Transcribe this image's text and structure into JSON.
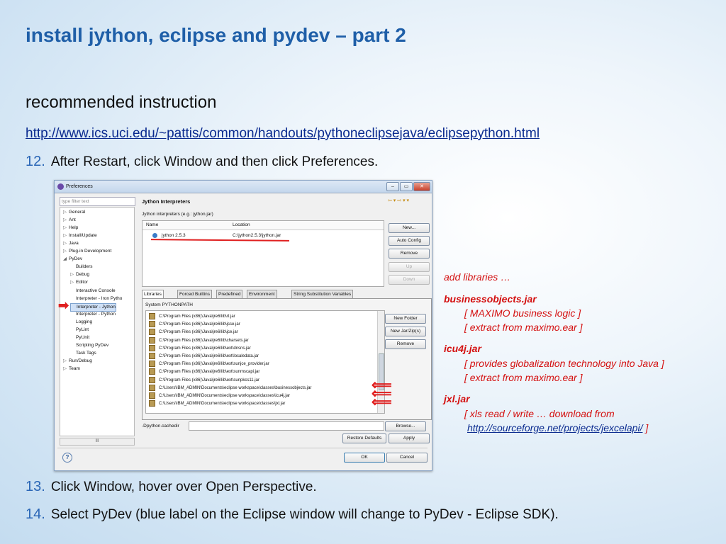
{
  "slide": {
    "title": "install jython, eclipse and pydev – part 2",
    "subtitle": "recommended instruction",
    "link": "http://www.ics.uci.edu/~pattis/common/handouts/pythoneclipsejava/eclipsepython.html",
    "steps": [
      {
        "num": "12.",
        "text": "After Restart, click Window and then click Preferences."
      },
      {
        "num": "13.",
        "text": "Click Window, hover over Open Perspective."
      },
      {
        "num": "14.",
        "text": "Select PyDev (blue label on the Eclipse window will change to PyDev - Eclipse SDK)."
      }
    ]
  },
  "dialog": {
    "title": "Preferences",
    "window_buttons": {
      "min": "–",
      "max": "▭",
      "close": "✕"
    },
    "filter_placeholder": "type filter text",
    "tree": [
      {
        "label": "General",
        "glyph": "▷"
      },
      {
        "label": "Ant",
        "glyph": "▷"
      },
      {
        "label": "Help",
        "glyph": "▷"
      },
      {
        "label": "Install/Update",
        "glyph": "▷"
      },
      {
        "label": "Java",
        "glyph": "▷"
      },
      {
        "label": "Plug-in Development",
        "glyph": "▷"
      },
      {
        "label": "PyDev",
        "glyph": "◢"
      },
      {
        "label": "Builders",
        "glyph": ""
      },
      {
        "label": "Debug",
        "glyph": "▷"
      },
      {
        "label": "Editor",
        "glyph": "▷"
      },
      {
        "label": "Interactive Console",
        "glyph": ""
      },
      {
        "label": "Interpreter - Iron Pytho",
        "glyph": ""
      },
      {
        "label": "Interpreter - Jython",
        "glyph": ""
      },
      {
        "label": "Interpreter - Python",
        "glyph": ""
      },
      {
        "label": "Logging",
        "glyph": ""
      },
      {
        "label": "PyLint",
        "glyph": ""
      },
      {
        "label": "PyUnit",
        "glyph": ""
      },
      {
        "label": "Scripting PyDev",
        "glyph": ""
      },
      {
        "label": "Task Tags",
        "glyph": ""
      },
      {
        "label": "Run/Debug",
        "glyph": "▷"
      },
      {
        "label": "Team",
        "glyph": "▷"
      }
    ],
    "tree_scroll": "III",
    "help": "?",
    "panel_title": "Jython Interpreters",
    "panel_sub": "Jython interpreters (e.g.: jython.jar)",
    "nav_icons": "⇦ ▾ ⇨ ▾ ▾",
    "table_headers": {
      "name": "Name",
      "location": "Location"
    },
    "interpreter": {
      "name": "jython 2.5.3",
      "location": "C:\\jython2.5.3\\jython.jar"
    },
    "buttons": {
      "new": "New...",
      "auto_config": "Auto Config",
      "remove": "Remove",
      "up": "Up",
      "down": "Down",
      "new_folder": "New Folder",
      "new_jar": "New Jar/Zip(s)",
      "remove2": "Remove",
      "browse": "Browse...",
      "restore": "Restore Defaults",
      "apply": "Apply",
      "ok": "OK",
      "cancel": "Cancel"
    },
    "tabs": [
      "Libraries",
      "Forced Builtins",
      "Predefined",
      "Environment",
      "String Substitution Variables"
    ],
    "pythonpath_label": "System PYTHONPATH",
    "libraries": [
      "C:\\Program Files (x86)\\Java\\jre6\\lib\\rt.jar",
      "C:\\Program Files (x86)\\Java\\jre6\\lib\\jsse.jar",
      "C:\\Program Files (x86)\\Java\\jre6\\lib\\jce.jar",
      "C:\\Program Files (x86)\\Java\\jre6\\lib\\charsets.jar",
      "C:\\Program Files (x86)\\Java\\jre6\\lib\\ext\\dnsns.jar",
      "C:\\Program Files (x86)\\Java\\jre6\\lib\\ext\\localedata.jar",
      "C:\\Program Files (x86)\\Java\\jre6\\lib\\ext\\sunjce_provider.jar",
      "C:\\Program Files (x86)\\Java\\jre6\\lib\\ext\\sunmscapi.jar",
      "C:\\Program Files (x86)\\Java\\jre6\\lib\\ext\\sunpkcs11.jar",
      "C:\\Users\\IBM_ADMIN\\Documents\\eclipse workspace\\classes\\businessobjects.jar",
      "C:\\Users\\IBM_ADMIN\\Documents\\eclipse workspace\\classes\\icu4j.jar",
      "C:\\Users\\IBM_ADMIN\\Documents\\eclipse workspace\\classes\\jxl.jar"
    ],
    "cache_label": "-Dpython.cachedir"
  },
  "notes": {
    "add_libraries": "add libraries …",
    "jar1": "businessobjects.jar",
    "jar1_l1": "[ MAXIMO business logic ]",
    "jar1_l2": "[ extract from maximo.ear ]",
    "jar2": "icu4j.jar",
    "jar2_l1": "[ provides globalization technology into Java ]",
    "jar2_l2": "[ extract from maximo.ear ]",
    "jar3": "jxl.jar",
    "jar3_l1": "[ xls read / write … download from",
    "jar3_link": "http://sourceforge.net/projects/jexcelapi/",
    "jar3_end": " ]"
  },
  "colors": {
    "title": "#1f5fa8",
    "annotation": "#d41010",
    "link": "#0a2a8f"
  }
}
